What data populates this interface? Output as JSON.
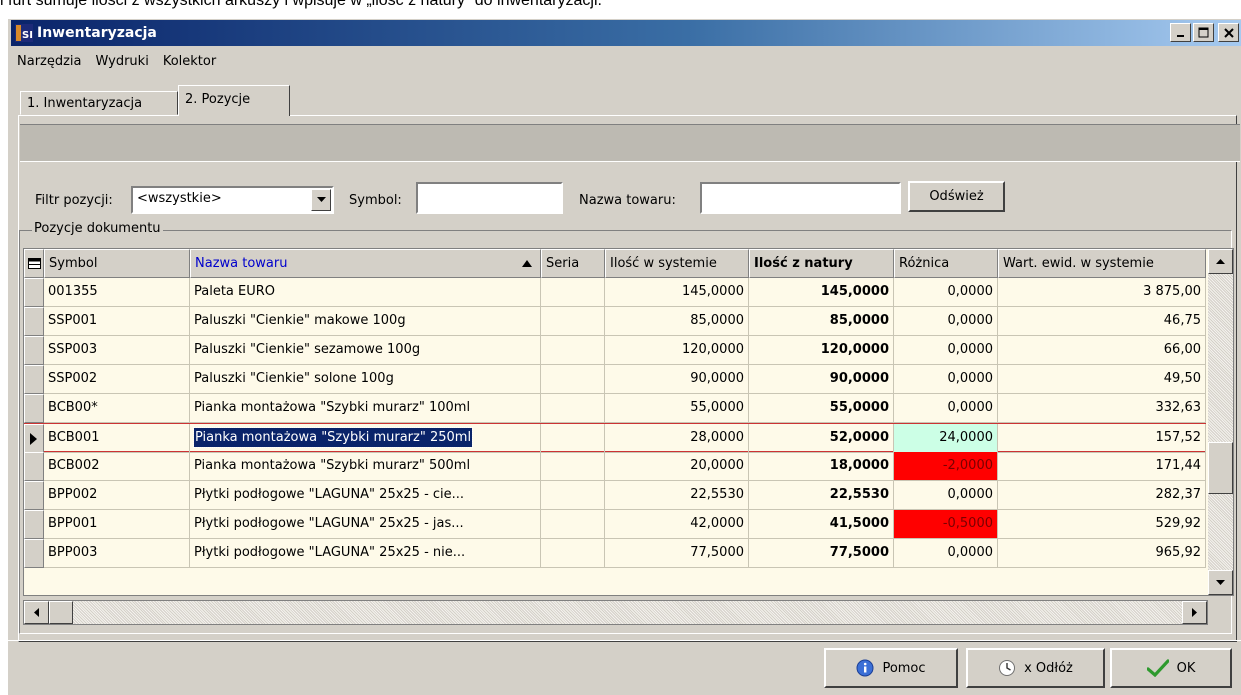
{
  "doc_text": "i furt sumuje ilości z wszystkich arkuszy i wpisuje w „ilość z natury” do inwentaryzacji.",
  "window": {
    "title": "Inwentaryzacja",
    "icon_text": "SII",
    "minimize": "_",
    "maximize": "□",
    "close": "×"
  },
  "menu": [
    "Narzędzia",
    "Wydruki",
    "Kolektor"
  ],
  "tabs": [
    "1. Inwentaryzacja",
    "2. Pozycje"
  ],
  "filter": {
    "label": "Filtr pozycji:",
    "value": "<wszystkie>",
    "symbol_label": "Symbol:",
    "symbol_value": "",
    "name_label": "Nazwa towaru:",
    "name_value": "",
    "refresh": "Odśwież"
  },
  "group_label": "Pozycje dokumentu",
  "columns": [
    "Symbol",
    "Nazwa towaru",
    "Seria",
    "Ilość w systemie",
    "Ilość z natury",
    "Różnica",
    "Wart. ewid. w systemie"
  ],
  "rows": [
    [
      "001355",
      "Paleta EURO",
      "",
      "145,0000",
      "145,0000",
      "0,0000",
      "3 875,00"
    ],
    [
      "SSP001",
      "Paluszki \"Cienkie\" makowe 100g",
      "",
      "85,0000",
      "85,0000",
      "0,0000",
      "46,75"
    ],
    [
      "SSP003",
      "Paluszki \"Cienkie\" sezamowe 100g",
      "",
      "120,0000",
      "120,0000",
      "0,0000",
      "66,00"
    ],
    [
      "SSP002",
      "Paluszki \"Cienkie\" solone 100g",
      "",
      "90,0000",
      "90,0000",
      "0,0000",
      "49,50"
    ],
    [
      "BCB00*",
      "Pianka montażowa \"Szybki murarz\" 100ml",
      "",
      "55,0000",
      "55,0000",
      "0,0000",
      "332,63"
    ],
    [
      "BCB001",
      "Pianka montażowa \"Szybki murarz\" 250ml",
      "",
      "28,0000",
      "52,0000",
      "24,0000",
      "157,52"
    ],
    [
      "BCB002",
      "Pianka montażowa \"Szybki murarz\" 500ml",
      "",
      "20,0000",
      "18,0000",
      "-2,0000",
      "171,44"
    ],
    [
      "BPP002",
      "Płytki podłogowe \"LAGUNA\" 25x25 - cie...",
      "",
      "22,5530",
      "22,5530",
      "0,0000",
      "282,37"
    ],
    [
      "BPP001",
      "Płytki podłogowe \"LAGUNA\" 25x25 - jas...",
      "",
      "42,0000",
      "41,5000",
      "-0,5000",
      "529,92"
    ],
    [
      "BPP003",
      "Płytki podłogowe \"LAGUNA\" 25x25 - nie...",
      "",
      "77,5000",
      "77,5000",
      "0,0000",
      "965,92"
    ]
  ],
  "selected_row": 5,
  "colors": {
    "positive": "#ccffe6",
    "negative": "#ff0000",
    "selection": "#0a246a",
    "grid_bg": "#fefae9"
  },
  "buttons": {
    "help": "Pomoc",
    "postpone": "x Odłóż",
    "ok": "OK"
  }
}
